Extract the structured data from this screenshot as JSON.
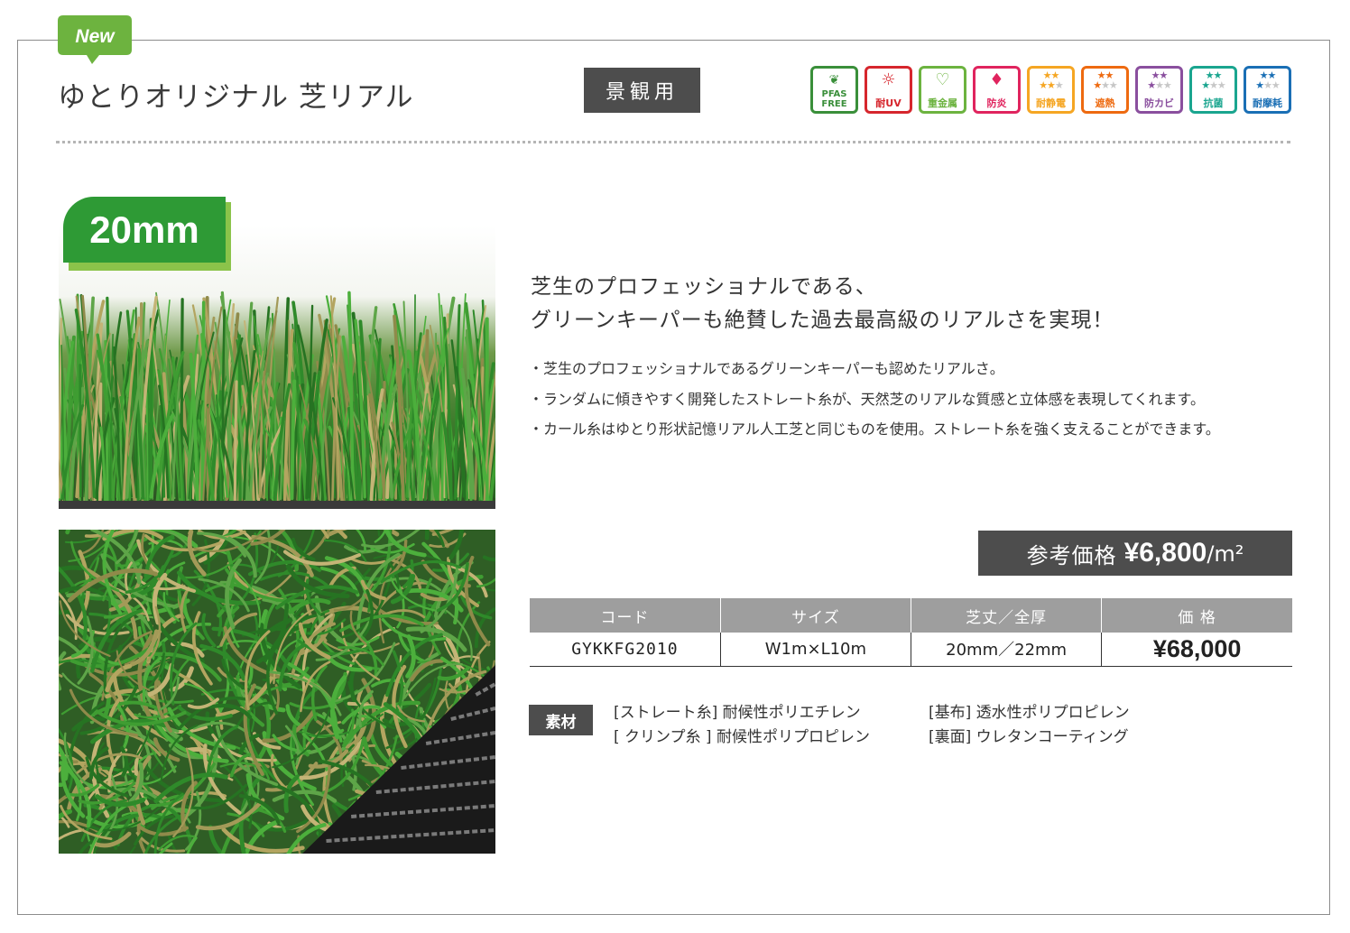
{
  "badge": {
    "new": "New"
  },
  "product": {
    "title": "ゆとりオリジナル 芝リアル",
    "usage": "景観用",
    "pile_badge": "20mm"
  },
  "feature_icons": [
    {
      "name": "pfas-free",
      "label_top": "PFAS",
      "label": "FREE",
      "color": "#3a8f3a"
    },
    {
      "name": "uv",
      "label": "耐UV",
      "color": "#d6262d"
    },
    {
      "name": "heavy-metal",
      "label": "重金属",
      "color": "#6cb33f"
    },
    {
      "name": "flame",
      "label": "防炎",
      "color": "#e0245e"
    },
    {
      "name": "antistatic",
      "label": "耐静電",
      "color": "#f5a623",
      "stars": 3
    },
    {
      "name": "heat-shield",
      "label": "遮熱",
      "color": "#ee6a10",
      "stars": 2
    },
    {
      "name": "mold",
      "label": "防カビ",
      "color": "#8a4f9e",
      "stars": 2
    },
    {
      "name": "antibacterial",
      "label": "抗菌",
      "color": "#1aa58f",
      "stars": 2
    },
    {
      "name": "wear",
      "label": "耐摩耗",
      "color": "#1a6fb5",
      "stars": 2
    }
  ],
  "description": {
    "headline_1": "芝生のプロフェッショナルである、",
    "headline_2": "グリーンキーパーも絶賛した過去最高級のリアルさを実現！",
    "bullets": [
      "・芝生のプロフェッショナルであるグリーンキーパーも認めたリアルさ。",
      "・ランダムに傾きやすく開発したストレート糸が、天然芝のリアルな質感と立体感を表現してくれます。",
      "・カール糸はゆとり形状記憶リアル人工芝と同じものを使用。ストレート糸を強く支えることができます。"
    ]
  },
  "reference_price": {
    "label": "参考価格",
    "value": "¥6,800",
    "unit": "/m²"
  },
  "spec_table": {
    "headers": [
      "コード",
      "サイズ",
      "芝丈／全厚",
      "価 格"
    ],
    "row": [
      "GYKKFG2010",
      "W1m×L10m",
      "20mm／22mm",
      "¥68,000"
    ]
  },
  "materials": {
    "tag": "素材",
    "items": [
      "[ストレート糸] 耐候性ポリエチレン",
      "[ クリンプ糸 ] 耐候性ポリプロピレン",
      "[基布] 透水性ポリプロピレン",
      "[裏面] ウレタンコーティング"
    ]
  },
  "colors": {
    "brand_green": "#2e9a35",
    "light_green": "#8bc34a",
    "dark_tag": "#4d4d4d",
    "table_header": "#9e9e9e"
  }
}
